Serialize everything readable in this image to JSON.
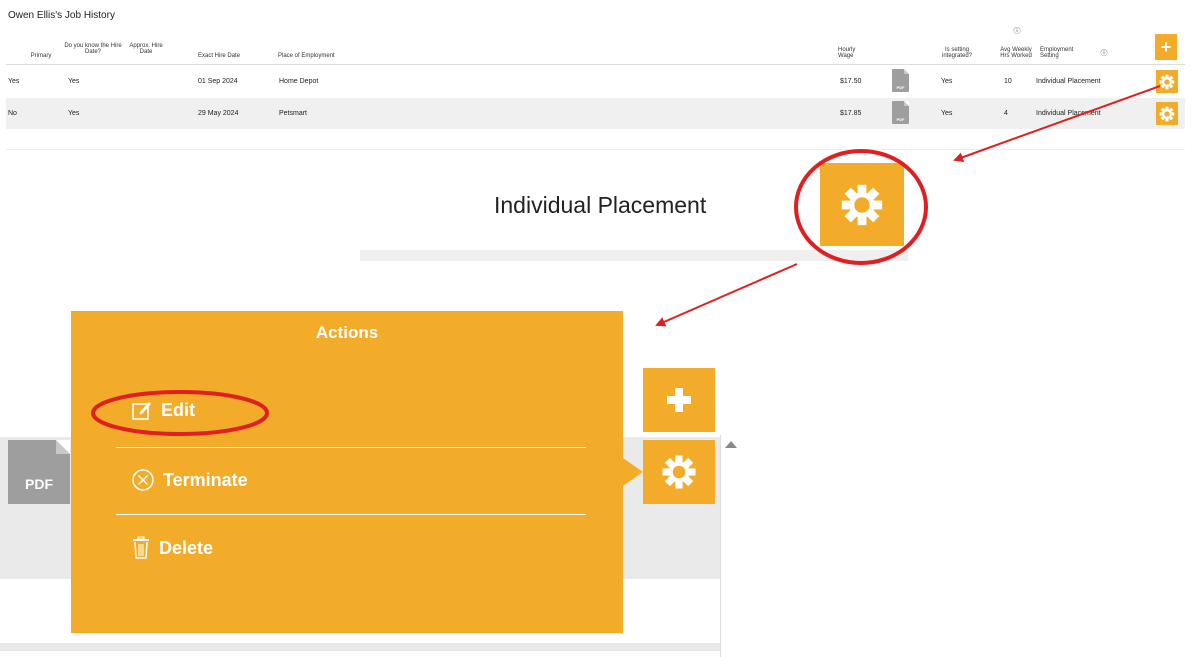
{
  "page": {
    "title": "Owen Ellis's Job History"
  },
  "table": {
    "headers": {
      "primary": "Primary",
      "know_hire_date": "Do you know the Hire Date?",
      "approx_hire_date": "Approx. Hire Date",
      "exact_hire_date": "Exact Hire Date",
      "place": "Place of Employment",
      "hourly_wage": "Hourly Wage",
      "integrated": "Is setting integrated?",
      "avg_hours": "Avg Weekly Hrs Worked",
      "setting": "Employment Setting"
    },
    "info_icon": "ⓘ",
    "rows": [
      {
        "primary": "Yes",
        "know": "Yes",
        "approx": "",
        "exact": "01 Sep 2024",
        "place": "Home Depot",
        "wage": "$17.50",
        "integrated": "Yes",
        "hours": "10",
        "setting": "Individual Placement"
      },
      {
        "primary": "No",
        "know": "Yes",
        "approx": "",
        "exact": "29 May 2024",
        "place": "Petsmart",
        "wage": "$17.85",
        "integrated": "Yes",
        "hours": "4",
        "setting": "Individual Placement"
      }
    ],
    "pdf_label": "PDF"
  },
  "zoom": {
    "label": "Individual Placement"
  },
  "actions_menu": {
    "title": "Actions",
    "items": [
      {
        "label": "Edit",
        "icon": "edit-icon"
      },
      {
        "label": "Terminate",
        "icon": "circle-x-icon"
      },
      {
        "label": "Delete",
        "icon": "trash-icon"
      }
    ]
  },
  "big_table": {
    "pdf_label": "PDF"
  },
  "colors": {
    "accent": "#f2ac2a",
    "annotation": "#e02020",
    "pdf_gray": "#9e9e9e"
  }
}
